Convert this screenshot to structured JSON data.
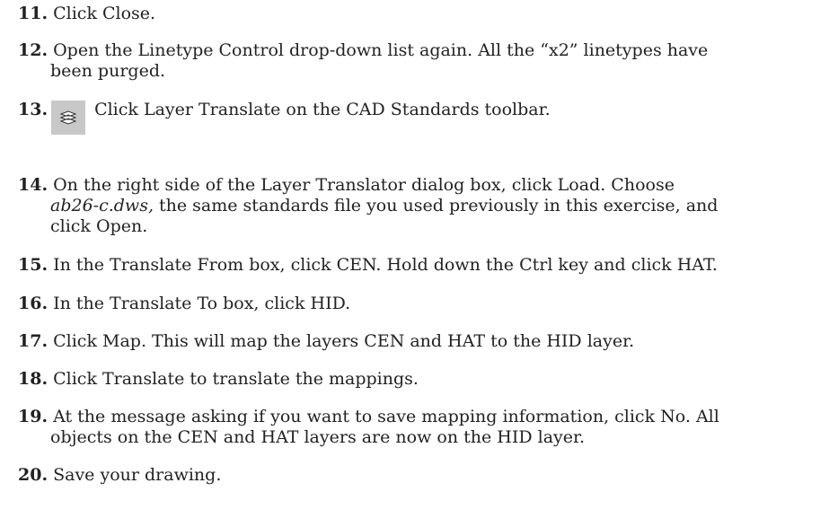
{
  "steps": [
    {
      "num": "11.",
      "text": "Click Close."
    },
    {
      "num": "12.",
      "line1": "Open the Linetype Control drop-down list again. All the “x2” linetypes have",
      "line2": "been purged."
    },
    {
      "num": "13.",
      "text": "Click Layer Translate on the CAD Standards toolbar.",
      "icon": "layer-translate-icon"
    },
    {
      "num": "14.",
      "line1": "On the right side of the Layer Translator dialog box, click Load. Choose",
      "italic": "ab26-c.dws,",
      "line2b": " the same standards file you used previously in this exercise, and",
      "line3": "click Open."
    },
    {
      "num": "15.",
      "text": "In the Translate From box, click CEN. Hold down the Ctrl key and click HAT."
    },
    {
      "num": "16.",
      "text": "In the Translate To box, click HID."
    },
    {
      "num": "17.",
      "text": "Click Map. This will map the layers CEN and HAT to the HID layer."
    },
    {
      "num": "18.",
      "text": "Click Translate to translate the mappings."
    },
    {
      "num": "19.",
      "line1": "At the message asking if you want to save mapping information, click No. All",
      "line2": "objects on the CEN and HAT layers are now on the HID layer."
    },
    {
      "num": "20.",
      "text": "Save your drawing."
    }
  ],
  "colors": {
    "icon_bg": "#c8c8c8",
    "text": "#222222"
  }
}
